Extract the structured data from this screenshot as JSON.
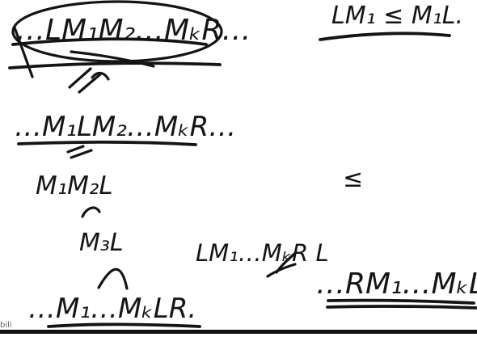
{
  "handwriting": {
    "top_left": "…LM₁M₂…MₖR…",
    "top_right": "LM₁ ≤ M₁L.",
    "line_2": "…M₁LM₂…MₖR…",
    "line_3": "M₁M₂L",
    "line_4": "M₃L",
    "line_5": "…M₁…MₖLR.",
    "middle_right": "LM₁…MₖR L",
    "right_bottom": "…RM₁…MₖL",
    "operator_le": "≤",
    "operator_eq": "=",
    "corner_mark": "bili"
  },
  "colors": {
    "ink": "#141414",
    "background": "#ffffff"
  }
}
